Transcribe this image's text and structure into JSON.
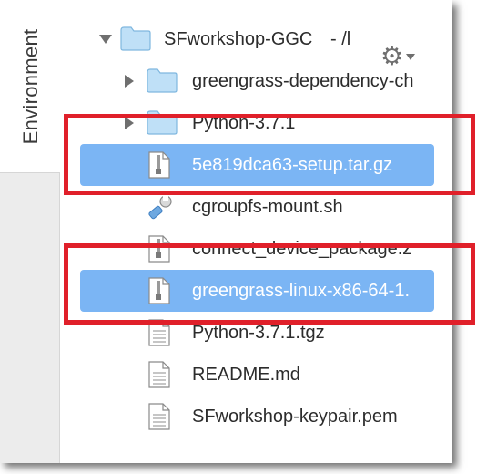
{
  "sidebar": {
    "environment_label": "Environment"
  },
  "tree": {
    "root": {
      "name": "SFworkshop-GGC",
      "path_hint": "- /l"
    },
    "items": [
      {
        "name": "greengrass-dependency-ch",
        "kind": "folder",
        "icon": "folder-icon"
      },
      {
        "name": "Python-3.7.1",
        "kind": "folder",
        "icon": "folder-icon"
      },
      {
        "name": "5e819dca63-setup.tar.gz",
        "kind": "file",
        "icon": "archive-icon",
        "selected": true
      },
      {
        "name": "cgroupfs-mount.sh",
        "kind": "file",
        "icon": "script-icon"
      },
      {
        "name": "connect_device_package.z",
        "kind": "file",
        "icon": "archive-icon"
      },
      {
        "name": "greengrass-linux-x86-64-1.",
        "kind": "file",
        "icon": "archive-icon",
        "selected": true
      },
      {
        "name": "Python-3.7.1.tgz",
        "kind": "file",
        "icon": "document-icon"
      },
      {
        "name": "README.md",
        "kind": "file",
        "icon": "document-icon"
      },
      {
        "name": "SFworkshop-keypair.pem",
        "kind": "file",
        "icon": "document-icon"
      }
    ]
  },
  "colors": {
    "selection": "#7bb5f4",
    "annotation": "#e0202a",
    "folder": "#bfe0f7"
  }
}
